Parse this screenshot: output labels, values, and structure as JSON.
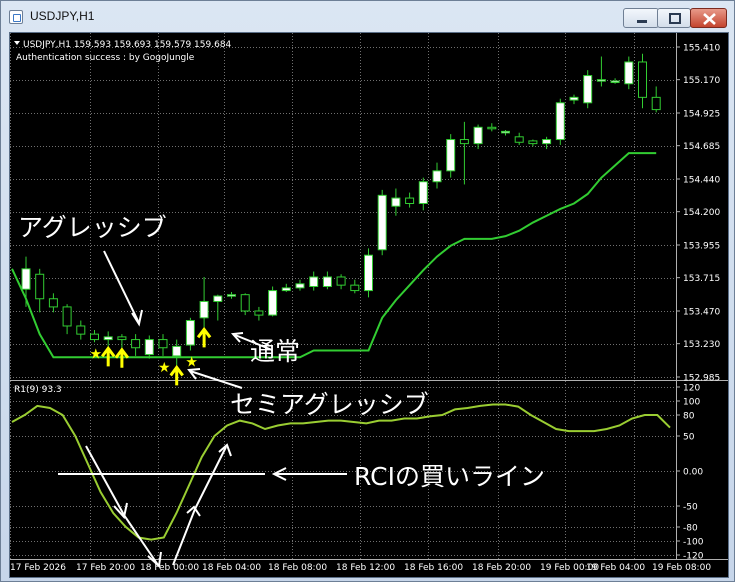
{
  "window": {
    "title": "USDJPY,H1"
  },
  "chart_header": {
    "symbol_line": "USDJPY,H1  159.593 159.693 159.579 159.684",
    "indicator_line": "Authentication success : by GogoJungle"
  },
  "subwindow_header": "R1(9) 93.3",
  "annotations": {
    "aggressive": "アグレッシブ",
    "normal": "通常",
    "semi_aggressive": "セミアグレッシブ",
    "rci_buy_line": "RCIの買いライン"
  },
  "colors": {
    "background": "#000000",
    "bull_candle": "#ffffff",
    "bear_candle": "#000000",
    "line": "#32cd32",
    "rci_line": "#9acd32",
    "arrow": "#ffff00",
    "grid": "#707070"
  },
  "chart_data": [
    {
      "type": "candlestick",
      "y_ticks": [
        "155.410",
        "155.170",
        "154.925",
        "154.685",
        "154.440",
        "154.200",
        "153.955",
        "153.715",
        "153.470",
        "153.230",
        "152.985"
      ],
      "ylim": [
        152.985,
        155.41
      ],
      "x_ticks": [
        "17 Feb 2026",
        "17 Feb 20:00",
        "18 Feb 00:00",
        "18 Feb 04:00",
        "18 Feb 08:00",
        "18 Feb 12:00",
        "18 Feb 16:00",
        "18 Feb 20:00",
        "19 Feb 00:00",
        "19 Feb 04:00",
        "19 Feb 08:00"
      ],
      "candles": [
        {
          "o": 153.63,
          "h": 153.87,
          "l": 153.5,
          "c": 153.78
        },
        {
          "o": 153.74,
          "h": 153.78,
          "l": 153.46,
          "c": 153.56
        },
        {
          "o": 153.56,
          "h": 153.6,
          "l": 153.46,
          "c": 153.5
        },
        {
          "o": 153.5,
          "h": 153.52,
          "l": 153.3,
          "c": 153.36
        },
        {
          "o": 153.36,
          "h": 153.4,
          "l": 153.26,
          "c": 153.3
        },
        {
          "o": 153.3,
          "h": 153.33,
          "l": 153.24,
          "c": 153.26
        },
        {
          "o": 153.26,
          "h": 153.32,
          "l": 153.21,
          "c": 153.28
        },
        {
          "o": 153.28,
          "h": 153.3,
          "l": 153.2,
          "c": 153.26
        },
        {
          "o": 153.26,
          "h": 153.3,
          "l": 153.14,
          "c": 153.2
        },
        {
          "o": 153.15,
          "h": 153.29,
          "l": 153.12,
          "c": 153.26
        },
        {
          "o": 153.26,
          "h": 153.3,
          "l": 153.14,
          "c": 153.2
        },
        {
          "o": 153.14,
          "h": 153.26,
          "l": 153.07,
          "c": 153.21
        },
        {
          "o": 153.22,
          "h": 153.42,
          "l": 153.18,
          "c": 153.4
        },
        {
          "o": 153.42,
          "h": 153.72,
          "l": 153.35,
          "c": 153.54
        },
        {
          "o": 153.54,
          "h": 153.59,
          "l": 153.4,
          "c": 153.58
        },
        {
          "o": 153.58,
          "h": 153.61,
          "l": 153.56,
          "c": 153.59
        },
        {
          "o": 153.59,
          "h": 153.6,
          "l": 153.44,
          "c": 153.47
        },
        {
          "o": 153.47,
          "h": 153.5,
          "l": 153.4,
          "c": 153.44
        },
        {
          "o": 153.44,
          "h": 153.65,
          "l": 153.43,
          "c": 153.62
        },
        {
          "o": 153.62,
          "h": 153.67,
          "l": 153.61,
          "c": 153.64
        },
        {
          "o": 153.64,
          "h": 153.7,
          "l": 153.62,
          "c": 153.67
        },
        {
          "o": 153.65,
          "h": 153.76,
          "l": 153.62,
          "c": 153.72
        },
        {
          "o": 153.65,
          "h": 153.76,
          "l": 153.63,
          "c": 153.72
        },
        {
          "o": 153.72,
          "h": 153.74,
          "l": 153.63,
          "c": 153.66
        },
        {
          "o": 153.66,
          "h": 153.7,
          "l": 153.6,
          "c": 153.62
        },
        {
          "o": 153.62,
          "h": 153.93,
          "l": 153.57,
          "c": 153.88
        },
        {
          "o": 153.92,
          "h": 154.36,
          "l": 153.88,
          "c": 154.32
        },
        {
          "o": 154.24,
          "h": 154.37,
          "l": 154.17,
          "c": 154.3
        },
        {
          "o": 154.3,
          "h": 154.34,
          "l": 154.23,
          "c": 154.26
        },
        {
          "o": 154.26,
          "h": 154.45,
          "l": 154.21,
          "c": 154.42
        },
        {
          "o": 154.42,
          "h": 154.56,
          "l": 154.37,
          "c": 154.5
        },
        {
          "o": 154.5,
          "h": 154.77,
          "l": 154.45,
          "c": 154.73
        },
        {
          "o": 154.73,
          "h": 154.86,
          "l": 154.4,
          "c": 154.7
        },
        {
          "o": 154.7,
          "h": 154.84,
          "l": 154.66,
          "c": 154.82
        },
        {
          "o": 154.82,
          "h": 154.85,
          "l": 154.79,
          "c": 154.81
        },
        {
          "o": 154.78,
          "h": 154.8,
          "l": 154.76,
          "c": 154.79
        },
        {
          "o": 154.75,
          "h": 154.78,
          "l": 154.69,
          "c": 154.71
        },
        {
          "o": 154.72,
          "h": 154.73,
          "l": 154.68,
          "c": 154.7
        },
        {
          "o": 154.7,
          "h": 154.75,
          "l": 154.66,
          "c": 154.73
        },
        {
          "o": 154.73,
          "h": 155.03,
          "l": 154.69,
          "c": 155.0
        },
        {
          "o": 155.02,
          "h": 155.06,
          "l": 154.99,
          "c": 155.04
        },
        {
          "o": 155.0,
          "h": 155.24,
          "l": 154.96,
          "c": 155.2
        },
        {
          "o": 155.16,
          "h": 155.34,
          "l": 155.12,
          "c": 155.17
        },
        {
          "o": 155.16,
          "h": 155.18,
          "l": 155.14,
          "c": 155.16
        },
        {
          "o": 155.14,
          "h": 155.34,
          "l": 155.1,
          "c": 155.3
        },
        {
          "o": 155.3,
          "h": 155.36,
          "l": 154.96,
          "c": 155.04
        },
        {
          "o": 155.04,
          "h": 155.12,
          "l": 154.93,
          "c": 154.95
        }
      ],
      "line_values": [
        153.56,
        153.3,
        153.13,
        153.13,
        153.13,
        153.13,
        153.13,
        153.13,
        153.13,
        153.13,
        153.13,
        153.13,
        153.13,
        153.13,
        153.13,
        153.13,
        153.13,
        153.13,
        153.13,
        153.13,
        153.13,
        153.18,
        153.18,
        153.18,
        153.18,
        153.18,
        153.42,
        153.55,
        153.66,
        153.77,
        153.87,
        153.95,
        154.0,
        154.0,
        154.0,
        154.02,
        154.06,
        154.12,
        154.17,
        154.22,
        154.26,
        154.33,
        154.45,
        154.54,
        154.63,
        154.63,
        154.63
      ],
      "signal_markers": [
        {
          "bar": 5,
          "type": "star"
        },
        {
          "bar": 6,
          "type": "arrow"
        },
        {
          "bar": 7,
          "type": "arrow"
        },
        {
          "bar": 10,
          "type": "star"
        },
        {
          "bar": 11,
          "type": "arrow"
        },
        {
          "bar": 12,
          "type": "star"
        },
        {
          "bar": 13,
          "type": "arrow"
        }
      ]
    },
    {
      "type": "line",
      "y_ticks": [
        "120",
        "100",
        "80",
        "50",
        "0.00",
        "-50",
        "-80",
        "-100",
        "-120"
      ],
      "ylim": [
        -120,
        120
      ],
      "buy_line": 0,
      "values": [
        70,
        80,
        93,
        90,
        80,
        50,
        10,
        -30,
        -60,
        -80,
        -95,
        -98,
        -95,
        -60,
        -20,
        20,
        50,
        65,
        72,
        68,
        60,
        65,
        68,
        68,
        70,
        72,
        72,
        70,
        68,
        72,
        72,
        75,
        75,
        78,
        80,
        88,
        90,
        93,
        95,
        95,
        92,
        80,
        70,
        60,
        57,
        57,
        57,
        60,
        65,
        75,
        80,
        80,
        62
      ]
    }
  ]
}
